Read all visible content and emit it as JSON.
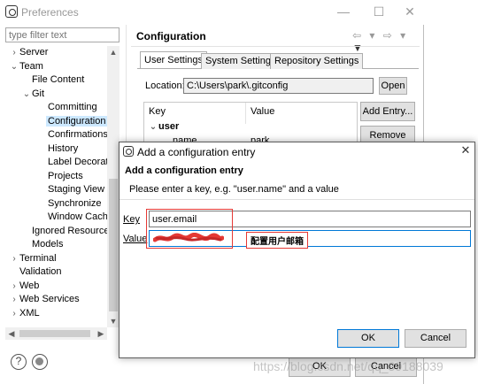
{
  "preferences": {
    "title": "Preferences",
    "filter_placeholder": "type filter text",
    "tree": [
      {
        "label": "Server",
        "chev": "›",
        "indent": 0
      },
      {
        "label": "Team",
        "chev": "⌄",
        "indent": 0
      },
      {
        "label": "File Content",
        "chev": "",
        "indent": 1
      },
      {
        "label": "Git",
        "chev": "⌄",
        "indent": 1
      },
      {
        "label": "Committing",
        "chev": "",
        "indent": 2
      },
      {
        "label": "Configuration",
        "chev": "",
        "indent": 2,
        "selected": true
      },
      {
        "label": "Confirmations a",
        "chev": "",
        "indent": 2
      },
      {
        "label": "History",
        "chev": "",
        "indent": 2
      },
      {
        "label": "Label Decoratio",
        "chev": "",
        "indent": 2
      },
      {
        "label": "Projects",
        "chev": "",
        "indent": 2
      },
      {
        "label": "Staging View",
        "chev": "",
        "indent": 2
      },
      {
        "label": "Synchronize",
        "chev": "",
        "indent": 2
      },
      {
        "label": "Window Cache",
        "chev": "",
        "indent": 2
      },
      {
        "label": "Ignored Resource",
        "chev": "",
        "indent": 1
      },
      {
        "label": "Models",
        "chev": "",
        "indent": 1
      },
      {
        "label": "Terminal",
        "chev": "›",
        "indent": 0
      },
      {
        "label": "Validation",
        "chev": "",
        "indent": 0
      },
      {
        "label": "Web",
        "chev": "›",
        "indent": 0
      },
      {
        "label": "Web Services",
        "chev": "›",
        "indent": 0
      },
      {
        "label": "XML",
        "chev": "›",
        "indent": 0
      }
    ],
    "page_title": "Configuration",
    "tabs": [
      "User Settings",
      "System Settings",
      "Repository Settings"
    ],
    "location_label": "Location:",
    "location_value": "C:\\Users\\park\\.gitconfig",
    "open_button": "Open",
    "grid_headers": [
      "Key",
      "Value"
    ],
    "grid_group": "user",
    "grid_row_key": "name",
    "grid_row_value": "park",
    "add_entry_button": "Add Entry...",
    "remove_button": "Remove",
    "ok_button": "OK",
    "cancel_button": "Cancel"
  },
  "dialog": {
    "title": "Add a configuration entry",
    "heading": "Add a configuration entry",
    "message": "Please enter a key, e.g. \"user.name\" and a value",
    "key_label": "Key",
    "key_value": "user.email",
    "value_label": "Value",
    "annotation": "配置用户邮箱",
    "ok_button": "OK",
    "cancel_button": "Cancel"
  },
  "watermark": "https://blog.csdn.net/qq_39188039",
  "colors": {
    "selection": "#cce8ff",
    "accent": "#0078d7",
    "annotation_red": "#e53935"
  }
}
